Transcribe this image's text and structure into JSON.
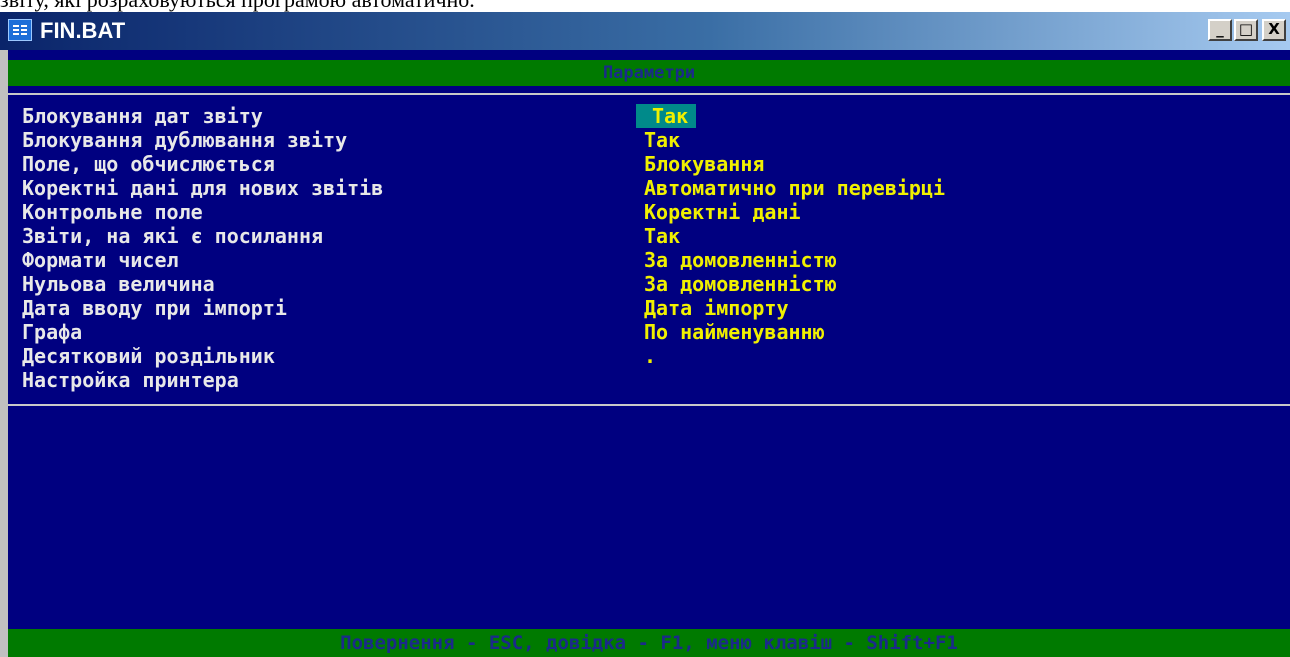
{
  "document_text": "звіту, які розраховуються програмою автоматично.",
  "window": {
    "title": "FIN.BAT",
    "minimize_label": "_",
    "maximize_label": "□",
    "close_label": "X"
  },
  "screen": {
    "header": "Параметри",
    "parameters": [
      {
        "label": "Блокування дат звіту",
        "value": "Так",
        "selected": true
      },
      {
        "label": "Блокування дублювання звіту",
        "value": "Так"
      },
      {
        "label": "Поле, що обчислюється",
        "value": "Блокування"
      },
      {
        "label": "Коректні дані для нових звітів",
        "value": "Автоматично при перевірці"
      },
      {
        "label": "Контрольне поле",
        "value": "Коректні дані"
      },
      {
        "label": "Звіти, на які є посилання",
        "value": "Так"
      },
      {
        "label": "Формати чисел",
        "value": "За домовленністю"
      },
      {
        "label": "Нульова величина",
        "value": "За домовленністю"
      },
      {
        "label": "Дата вводу при імпорті",
        "value": "Дата імпорту"
      },
      {
        "label": "Графа",
        "value": "По найменуванню"
      },
      {
        "label": "Десятковий роздільник",
        "value": "."
      },
      {
        "label": "Настройка принтера",
        "value": ""
      }
    ],
    "status": "Повернення - ESC, довідка - F1, меню клавіш - Shift+F1"
  },
  "colors": {
    "console_bg": "#000080",
    "bar_bg": "#007a00",
    "label_text": "#e8e8e8",
    "value_text": "#f0f000",
    "selection_bg": "#008a8a"
  }
}
